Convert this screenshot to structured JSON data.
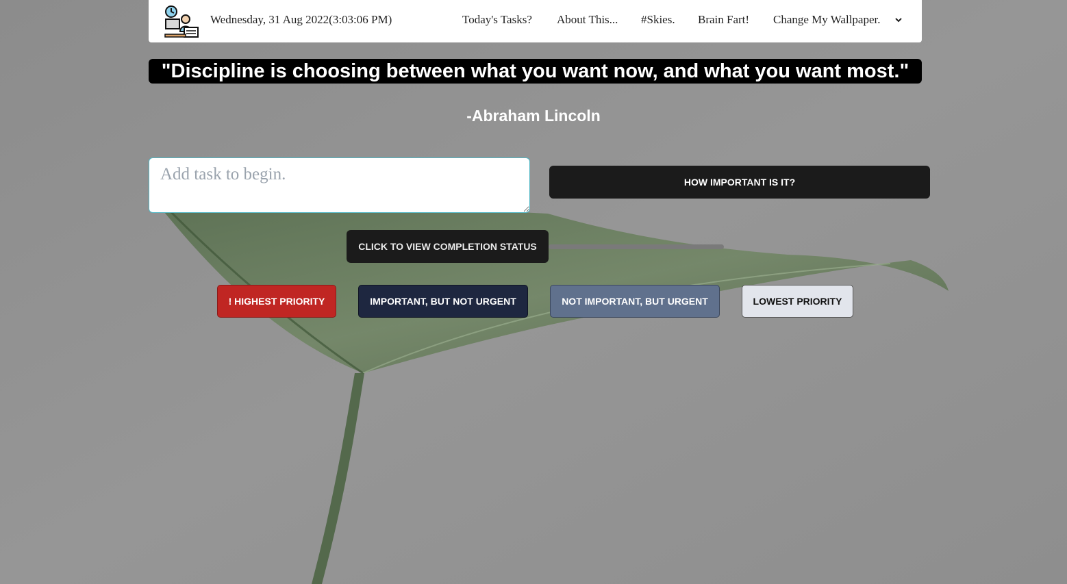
{
  "header": {
    "datetime": "Wednesday, 31 Aug 2022(3:03:06 PM)",
    "logo_icon": "desk-worker-clock-icon",
    "nav": [
      {
        "label": "Today's Tasks?"
      },
      {
        "label": "About This..."
      },
      {
        "label": "#Skies."
      },
      {
        "label": "Brain Fart!"
      },
      {
        "label": "Change My Wallpaper."
      }
    ],
    "dropdown_icon": "chevron-down-icon"
  },
  "quote": {
    "text": "\"Discipline is choosing between what you want now, and what you want most.\"",
    "author": "-Abraham Lincoln"
  },
  "task": {
    "placeholder": "Add task to begin.",
    "importance_label": "HOW IMPORTANT IS IT?"
  },
  "completion": {
    "label": "CLICK TO VIEW COMPLETION STATUS",
    "progress_fraction": 0
  },
  "priorities": [
    {
      "label": "! HIGHEST PRIORITY",
      "color": "#c02623"
    },
    {
      "label": "IMPORTANT, BUT NOT URGENT",
      "color": "#1e2740"
    },
    {
      "label": "NOT IMPORTANT, BUT URGENT",
      "color": "#60718d"
    },
    {
      "label": "LOWEST PRIORITY",
      "color": "#e2e5ec"
    }
  ],
  "background": {
    "description_icon": "leaf-wallpaper",
    "color": "#8f8f8f"
  }
}
